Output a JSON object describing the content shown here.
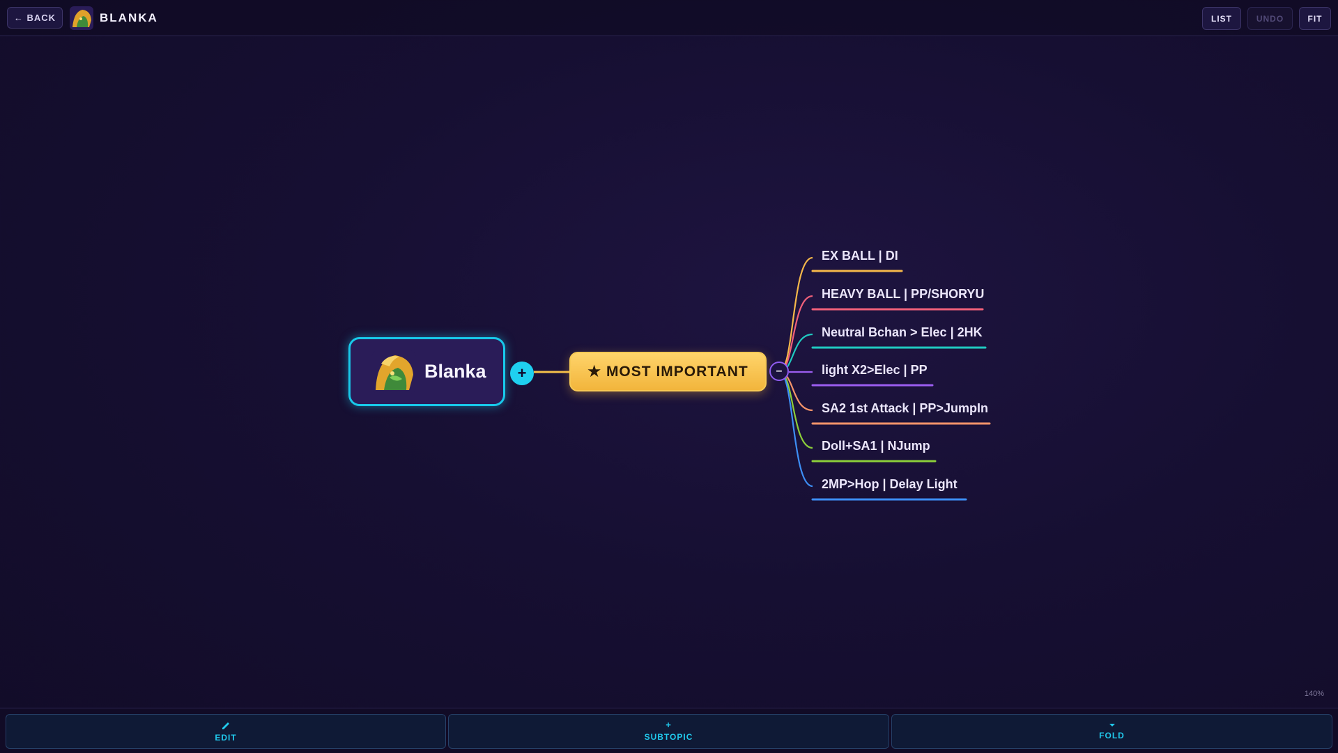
{
  "header": {
    "back_label": "← BACK",
    "title": "BLANKA",
    "buttons": {
      "list": "LIST",
      "undo": "UNDO",
      "fit": "FIT"
    }
  },
  "mindmap": {
    "root": {
      "label": "Blanka",
      "expand_symbol": "+"
    },
    "topic": {
      "label": "★ MOST IMPORTANT",
      "fold_symbol": "–"
    },
    "branches": [
      {
        "label": "EX BALL | DI",
        "color": "#f5b84a"
      },
      {
        "label": "HEAVY BALL | PP/SHORYU",
        "color": "#f0607a"
      },
      {
        "label": "Neutral Bchan > Elec | 2HK",
        "color": "#20c9c0"
      },
      {
        "label": "light X2>Elec | PP",
        "color": "#9b5df0"
      },
      {
        "label": "SA2 1st Attack | PP>JumpIn",
        "color": "#f5946a"
      },
      {
        "label": "Doll+SA1 | NJump",
        "color": "#8ccf3a"
      },
      {
        "label": "2MP>Hop | Delay Light",
        "color": "#3d8ef5"
      }
    ],
    "topic_color": "#f5c04a"
  },
  "zoom_level": "140%",
  "footer": {
    "edit_label": "EDIT",
    "subtopic_label": "SUBTOPIC",
    "subtopic_icon": "+",
    "fold_label": "FOLD"
  }
}
